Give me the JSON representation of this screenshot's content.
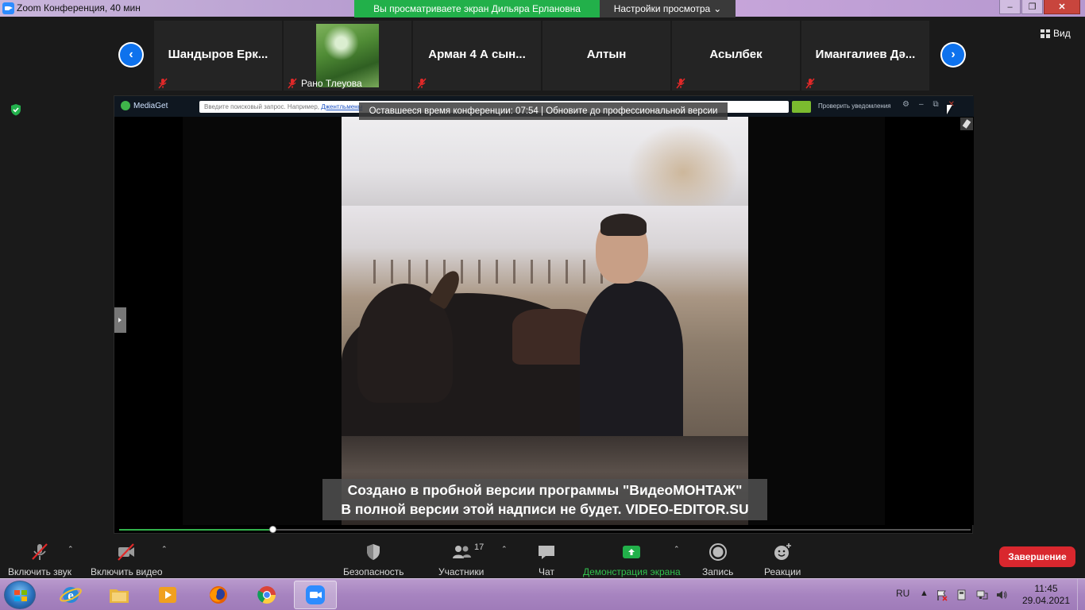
{
  "window": {
    "title": "Zoom Конференция, 40 мин",
    "minimize": "–",
    "maximize": "❐",
    "close": "✕"
  },
  "banner": {
    "viewing": "Вы просматриваете экран Дильяра Ерлановна",
    "view_options": "Настройки просмотра",
    "view_options_caret": "⌄"
  },
  "view_button": {
    "label": "Вид"
  },
  "gallery": {
    "prev": "‹",
    "next": "›",
    "tiles": [
      {
        "name": "Шандыров  Ерк...",
        "muted": true
      },
      {
        "name": "Рано Тлеуова",
        "muted": true
      },
      {
        "name": "Арман 4 А сын...",
        "muted": true
      },
      {
        "name": "Алтын",
        "muted": false
      },
      {
        "name": "Асылбек",
        "muted": true
      },
      {
        "name": "Имангалиев  Дә...",
        "muted": true
      }
    ]
  },
  "shared_screen": {
    "app": {
      "logo": "MediaGet",
      "search_placeholder": "Введите поисковый запрос. Например, ",
      "search_example": "Джентльмены",
      "notify": "Проверить уведомления",
      "settings": "⚙",
      "minimize": "–",
      "maximize": "⧉",
      "close": "✕"
    },
    "timer_overlay": "Оставшееся время конференции: 07:54 | Обновите до профессиональной версии",
    "watermark": {
      "line1": "Создано в пробной версии программы \"ВидеоМОНТАЖ\"",
      "line2": "В полной версии этой надписи не будет. VIDEO-EDITOR.SU"
    },
    "progress": 0.18
  },
  "toolbar": {
    "audio": "Включить звук",
    "video": "Включить видео",
    "security": "Безопасность",
    "participants": "Участники",
    "participants_count": "17",
    "chat": "Чат",
    "share": "Демонстрация экрана",
    "record": "Запись",
    "reactions": "Реакции",
    "end": "Завершение",
    "caret": "⌃"
  },
  "taskbar": {
    "language": "RU",
    "tray_arrow": "▲",
    "time": "11:45",
    "date": "29.04.2021"
  },
  "colors": {
    "zoom_blue": "#0e72ed",
    "banner_green": "#22b04a",
    "end_red": "#d9272e",
    "share_green": "#31c24d",
    "mute_red": "#e02828"
  }
}
